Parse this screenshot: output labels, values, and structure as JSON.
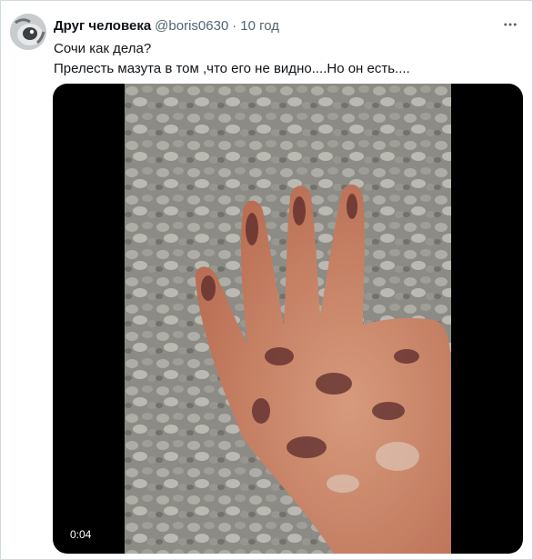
{
  "tweet": {
    "display_name": "Друг человека",
    "handle": "@boris0630",
    "separator": "·",
    "time": "10 год",
    "lines": [
      "Сочи как дела?",
      "Прелесть мазута в том ,что его не видно....Но он есть...."
    ],
    "more_icon": "more-dots-icon"
  },
  "media": {
    "duration": "0:04",
    "colors": {
      "background": "#000000",
      "pebbles": "#9a968d",
      "hand": "#c98466",
      "oil": "#5a2a2a"
    }
  }
}
